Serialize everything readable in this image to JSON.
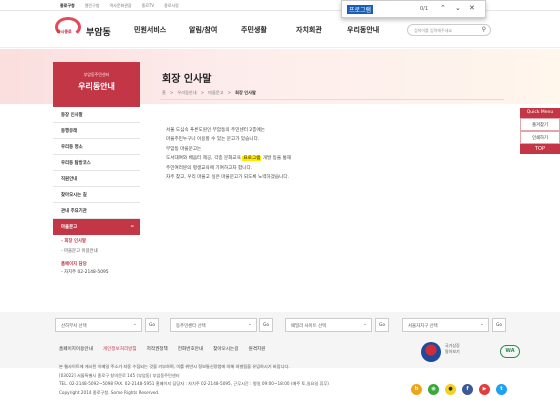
{
  "topbar": {
    "home": "종로구청",
    "links": [
      "열린구청",
      "역사문화관광",
      "종로TV",
      "종로사랑"
    ]
  },
  "find": {
    "query": "프로그램",
    "count": "0/1"
  },
  "header": {
    "logo_text": "다시종로",
    "dong": "부암동",
    "menu": [
      "민원서비스",
      "알림/참여",
      "주민생활",
      "자치회관",
      "우리동안내"
    ],
    "search_placeholder": "검색어를 입력해주세요"
  },
  "sidebar": {
    "subtitle": "부암동주민센터",
    "title": "우리동안내",
    "items": [
      "동장 인사말",
      "동행유래",
      "우리동 명소",
      "우리동 탐방코스",
      "직원안내",
      "찾아오시는 길",
      "관내 주요기관"
    ],
    "active": "마을문고",
    "subitems": [
      "- 회장 인사말",
      "- 마을문고 이용안내"
    ],
    "contact_label": "홈페이지 담당",
    "contact_value": "- 자치주 02-2148-5095"
  },
  "page": {
    "title": "회장 인사말",
    "breadcrumb": [
      "홈",
      ">",
      "우리동안내",
      ">",
      "마을문고",
      ">",
      "회장 인사말"
    ],
    "greeting": "서울 도심속 푸른도원인 부암동의 주민센터 2층에는",
    "lines": [
      "마을주민누구나 이용할 수 있는 문고가 있습니다.",
      "부암동 마을문고는",
      "주민여러분의 평생교육에 기여하고자 합니다.",
      "자주 찾고, 우리 마을고 싶은 마을문고가 되도록 노력하겠습니다."
    ],
    "hl_before": "도서대여와 배움터 제공, 각종 문화교육 ",
    "hl_word": "프로그램",
    "hl_after": " 개발 등을 통해"
  },
  "quick": {
    "head": "Quick Menu",
    "buttons": [
      "즐겨찾기",
      "인쇄하기"
    ],
    "top": "TOP"
  },
  "footer": {
    "selects": [
      "산하부서 선택",
      "동주민센터 선택",
      "패밀리 사이트 선택",
      "서울자치구 선택"
    ],
    "go": "Go",
    "links": [
      "홈페이지이용안내",
      "개인정보처리방침",
      "저작권정책",
      "전화번호안내",
      "찾아오시는길",
      "원격지원"
    ],
    "address_lines": [
      "본 웹사이트에 게시된 이메일 주소가 자동 수집되는 것을 거부하며, 이를 위반시 정보통신망법에 의해 처벌됨을 유념하시기 바랍니다.",
      "[03022] 서울특별시 종로구 창의문로 145 (부암동) 부암동주민센터",
      "TEL. 02-2148-5092~5098 FAX. 02-2148-5951 홈페이지 담당자 : 자치주 02-2148-5095, 근무시간 : 평일 09:00~18:00 (매주 토,일요일 휴무)",
      "Copyright 2014 종로구청. Some Rights Reserved."
    ],
    "badge_text": "국가상징\n알아보기",
    "webaward": "WA",
    "colors": {
      "brand": "#c33646",
      "hero_left": "#fbdede"
    }
  }
}
